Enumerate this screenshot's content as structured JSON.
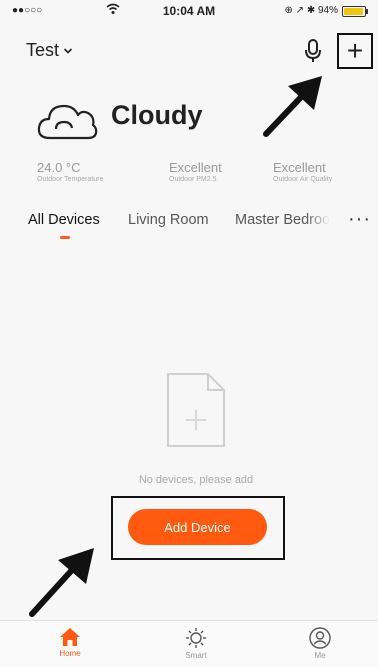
{
  "status_bar": {
    "carrier": "●●○○○",
    "time": "10:04 AM",
    "indicators": "⊕ ↗ ✱ 94%",
    "battery_percent": 94
  },
  "header": {
    "home_name": "Test",
    "add_label": "+"
  },
  "weather": {
    "condition": "Cloudy",
    "stats": [
      {
        "value": "24.0 °C",
        "label": "Outdoor Temperature"
      },
      {
        "value": "Excellent",
        "label": "Outdoor PM2.5"
      },
      {
        "value": "Excellent",
        "label": "Outdoor Air Quality"
      }
    ]
  },
  "tabs": [
    {
      "label": "All Devices",
      "active": true
    },
    {
      "label": "Living Room",
      "active": false
    },
    {
      "label": "Master Bedroom",
      "active": false
    }
  ],
  "more_label": "···",
  "empty": {
    "message": "No devices, please add",
    "button": "Add Device"
  },
  "bottom_nav": [
    {
      "label": "Home",
      "icon": "home-icon",
      "active": true
    },
    {
      "label": "Smart",
      "icon": "sun-icon",
      "active": false
    },
    {
      "label": "Me",
      "icon": "user-icon",
      "active": false
    }
  ],
  "colors": {
    "accent": "#ff5a10",
    "background": "#f7f7f8"
  }
}
